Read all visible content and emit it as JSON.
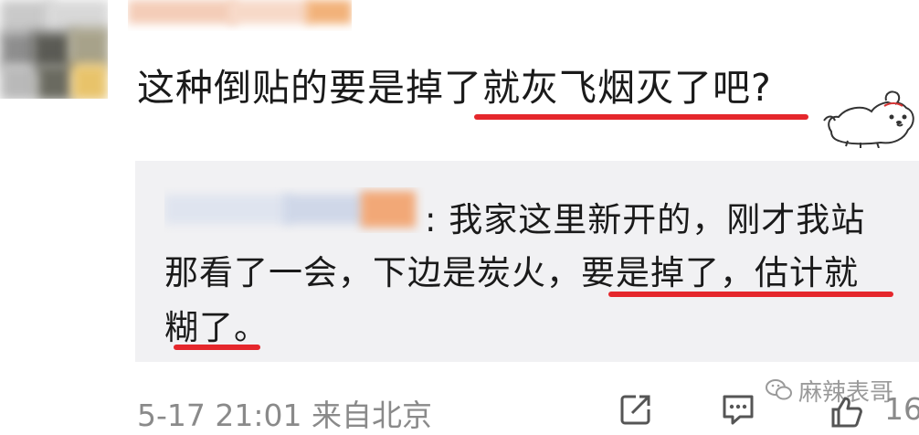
{
  "comment": {
    "text": "这种倒贴的要是掉了就灰飞烟灭了吧?"
  },
  "reply": {
    "line1": ": 我家这里新开的，刚才我站",
    "line2": "那看了一会，下边是炭火，要是掉了，估计就",
    "line3": "糊了。"
  },
  "footer": {
    "time_location": "5-17 21:01 来自北京",
    "like_count": "16"
  },
  "watermark": {
    "text": "麻辣表哥"
  },
  "colors": {
    "highlight_underline": "#e5272c",
    "reply_background": "#f1f1f3",
    "meta_text": "#8a8a8a"
  },
  "icons": {
    "share": "share-icon",
    "comment": "comment-icon",
    "like": "thumbs-up-icon",
    "watermark": "wechat-icon"
  }
}
